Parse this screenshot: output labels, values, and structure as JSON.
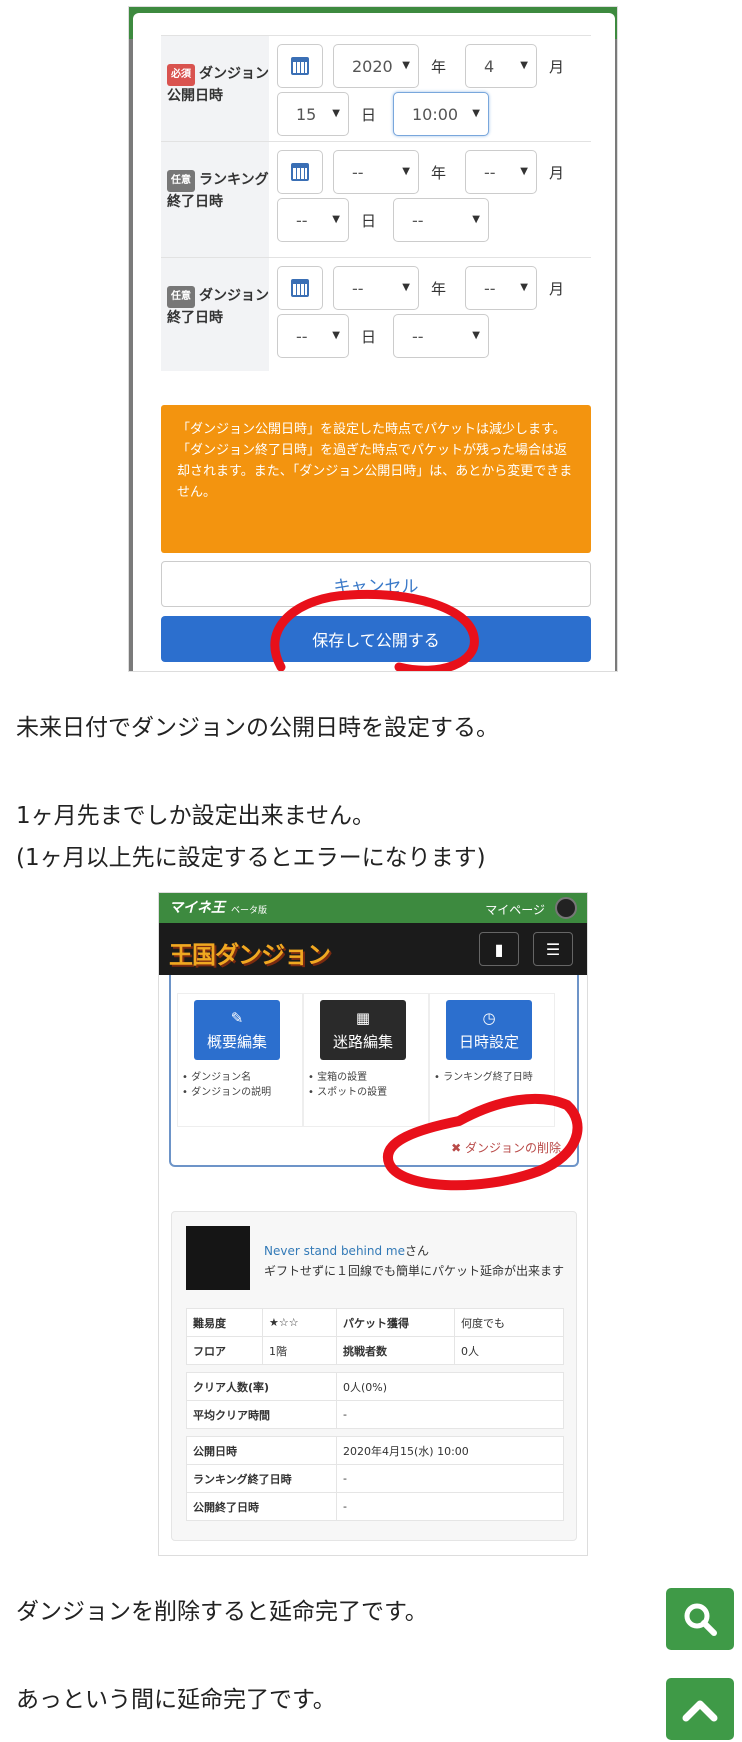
{
  "modal": {
    "rows": [
      {
        "badge": "必須",
        "label": "ダンジョン公開日時",
        "year": "2020",
        "year_unit": "年",
        "month": "4",
        "month_unit": "月",
        "day": "15",
        "day_unit": "日",
        "time": "10:00"
      },
      {
        "badge": "任意",
        "label": "ランキング終了日時",
        "year": "--",
        "year_unit": "年",
        "month": "--",
        "month_unit": "月",
        "day": "--",
        "day_unit": "日",
        "time": "--"
      },
      {
        "badge": "任意",
        "label": "ダンジョン終了日時",
        "year": "--",
        "year_unit": "年",
        "month": "--",
        "month_unit": "月",
        "day": "--",
        "day_unit": "日",
        "time": "--"
      }
    ],
    "notice": "「ダンジョン公開日時」を設定した時点でパケットは減少します。「ダンジョン終了日時」を過ぎた時点でパケットが残った場合は返却されます。また、「ダンジョン公開日時」は、あとから変更できません。",
    "cancel_label": "キャンセル",
    "save_label": "保存して公開する",
    "select_arrow": "▼"
  },
  "article": {
    "p1": "未来日付でダンジョンの公開日時を設定する。",
    "p2": "1ヶ月先までしか設定出来ません。",
    "p3": "(1ヶ月以上先に設定するとエラーになります)",
    "p4": "ダンジョンを削除すると延命完了です。",
    "p5": "あっという間に延命完了です。"
  },
  "screenshot2": {
    "brand_small": "マイネ王",
    "beta": "ベータ版",
    "mypage": "マイページ",
    "logo": "王国ダンジョン",
    "tiles": [
      {
        "label": "概要編集",
        "icon": "pencil-icon",
        "items": [
          "ダンジョン名",
          "ダンジョンの説明"
        ]
      },
      {
        "label": "迷路編集",
        "icon": "grid-icon",
        "items": [
          "宝箱の設置",
          "スポットの設置"
        ]
      },
      {
        "label": "日時設定",
        "icon": "clock-icon",
        "items": [
          "ランキング終了日時"
        ]
      }
    ],
    "delete_label": "ダンジョンの削除",
    "user_name": "Never stand behind me",
    "user_suffix": "さん",
    "description": "ギフトせずに１回線でも簡単にパケット延命が出来ます",
    "info": {
      "difficulty_label": "難易度",
      "difficulty_value": "★☆☆",
      "packet_label": "パケット獲得",
      "packet_value": "何度でも",
      "floor_label": "フロア",
      "floor_value": "1階",
      "challengers_label": "挑戦者数",
      "challengers_value": "0人",
      "clear_label": "クリア人数(率)",
      "clear_value": "0人(0%)",
      "avg_label": "平均クリア時間",
      "avg_value": "-",
      "pub_label": "公開日時",
      "pub_value": "2020年4月15(水) 10:00",
      "rank_end_label": "ランキング終了日時",
      "rank_end_value": "-",
      "pub_end_label": "公開終了日時",
      "pub_end_value": "-"
    }
  },
  "colors": {
    "accent_green": "#3f9a47",
    "primary_blue": "#2c6fce",
    "notice_orange": "#f3940f",
    "annotation_red": "#e8101a"
  }
}
